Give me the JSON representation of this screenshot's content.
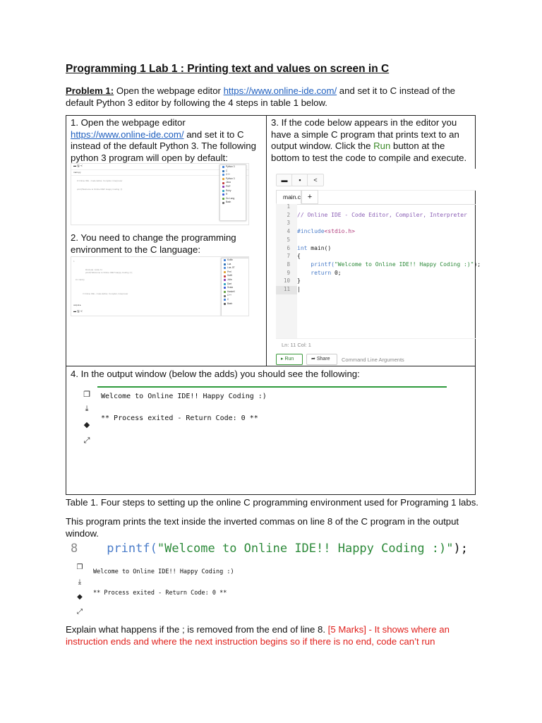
{
  "title": "Programming 1 Lab 1 : Printing text and values on screen in C",
  "problem": {
    "label": "Problem 1:",
    "text_a": " Open the webpage editor ",
    "link": "https://www.online-ide.com/",
    "text_b": "  and set it to C instead of the",
    "text_c": "default Python 3 editor by following the 4 steps in table 1 below."
  },
  "step1": {
    "line1": "1. Open the webpage editor",
    "link": "https://www.online-ide.com/",
    "line2_rest": "  and set it to C",
    "line3": "instead of the default Python 3. The following",
    "line4": "python 3 program will open by default:"
  },
  "step2": {
    "line1": "2. You need to change the programming",
    "line2": "environment to the C language:"
  },
  "step3": {
    "line1": "3. If the code below appears in the editor you",
    "line2": "have a simple C program that prints text to an",
    "line3a": "output window.  Click the ",
    "run_word": "Run",
    "line3b": " button at the",
    "line4": "bottom to test the code to compile and execute."
  },
  "step4": {
    "line1": "4. In the output window (below the adds) you should see the following:"
  },
  "editor": {
    "tab": "main.c",
    "tab_add": "+",
    "line_numbers": [
      "1",
      "2",
      "3",
      "4",
      "5",
      "6",
      "7",
      "8",
      "9",
      "10",
      "11"
    ],
    "comment": "// Online IDE - Code Editor, Compiler, Interpreter",
    "include_kw": "#include",
    "include_hdr": "<stdio.h>",
    "main_kw": "int",
    "main_rest": " main()",
    "open_brace": "{",
    "printf_fn": "printf(",
    "printf_str": "\"Welcome to Online IDE!! Happy Coding :)\"",
    "printf_end": ");",
    "return_kw": "return",
    "return_rest": " 0;",
    "close_brace": "}",
    "status": "Ln: 11  Col: 1",
    "run_label": "Run",
    "share_label": "Share",
    "cmd_args": "Command Line Arguments"
  },
  "output": {
    "line1": "Welcome to Online IDE!! Happy Coding :)",
    "line2": "** Process exited - Return Code: 0 **"
  },
  "caption": "Table 1.  Four steps to setting up the online C programming environment used for Programing 1 labs.",
  "explain": {
    "line1": "This program prints the text inside the inverted commas on line 8 of the C program in the output",
    "line2": "window."
  },
  "bigcode": {
    "num": "8",
    "fn": "printf(",
    "str": "\"Welcome to Online IDE!! Happy Coding :)\"",
    "end": ");"
  },
  "question": {
    "text": "Explain what happens if the ; is removed from the end of line 8. ",
    "answer_a": "[5 Marks] - It shows where an",
    "answer_b": "instruction ends and where the next instruction begins so if there is no end, code can’t run"
  },
  "mini1": {
    "tab": "main.py",
    "code1": "# Online IDE - Code Editor, Compiler, Interpreter",
    "code2": "print('Welcome to Online IDE!! Happy Coding :)')",
    "menu": [
      "Python 3",
      "C",
      "C++",
      "Python 3",
      "Java",
      "PHP",
      "Ruby",
      "R",
      "Go Lang",
      "Bash"
    ]
  },
  "mini2": {
    "code1": "int main()",
    "code2": "printf(\"Welcome to Online IDE!! Happy Coding :)\");",
    "code3": "// Online IDE - Code Editor, Compiler, Interpreter",
    "menu": [
      "Kotlin",
      "Lua",
      "Lua JIT",
      "Perl",
      "Swift",
      "Julia",
      "Dart",
      "Scala",
      "Haskell",
      "C++",
      "C",
      "Bash"
    ]
  },
  "colors": {
    "link": "#1f5fbf",
    "run_green": "#3c8a28",
    "answer_red": "#e0201c",
    "output_bar": "#2e9a3c"
  }
}
